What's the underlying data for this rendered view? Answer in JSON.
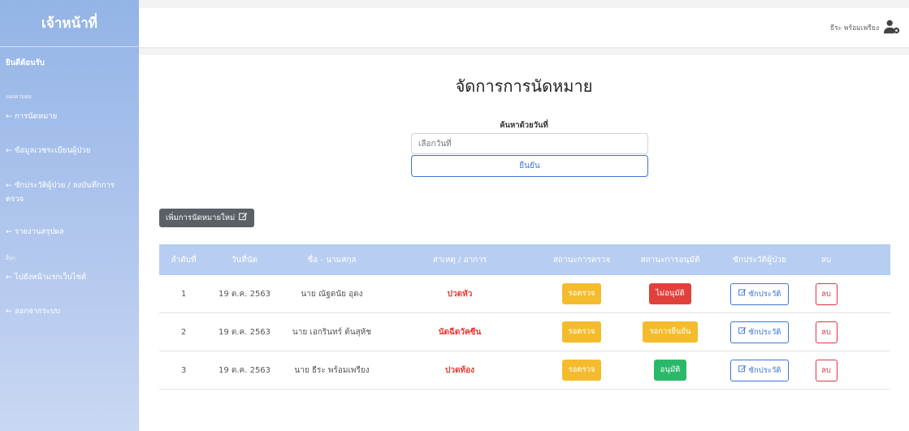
{
  "sidebar": {
    "brand": "เจ้าหน้าที่",
    "welcome": "ยินดีต้อนรับ",
    "section_control": "แผงควบคุม",
    "items": [
      {
        "label": "← การนัดหมาย"
      },
      {
        "label": "← ข้อมูลเวชระเบียนผู้ป่วย"
      },
      {
        "label": "← ซักประวัติผู้ป่วย / ลงบันทึกการ"
      },
      {
        "label": "ตรวจ"
      },
      {
        "label": "← รายงานสรุปผล"
      }
    ],
    "section_other": "อื่นๆ",
    "other_items": [
      {
        "label": "← ไปยังหน้าแรกเว็บไซต์"
      },
      {
        "label": "← ออกจากระบบ"
      }
    ]
  },
  "topbar": {
    "user_name": "ธีระ พร้อมเพรียง",
    "user_icon": "user-cog-icon"
  },
  "main": {
    "title": "จัดการการนัดหมาย",
    "search_label": "ค้นหาด้วยวันที่",
    "date_placeholder": "เลือกวันที่",
    "confirm_label": "ยืนยัน",
    "add_label": "เพิ่มการนัดหมายใหม่"
  },
  "table": {
    "headers": [
      "ลำดับที่",
      "วันที่นัด",
      "ชื่อ - นามสกุล",
      "สาเหตุ / อาการ",
      "สถานะการตรวจ",
      "สถานะการอนุมัติ",
      "ซักประวัติผู้ป่วย",
      "ลบ"
    ],
    "rows": [
      {
        "no": "1",
        "date": "19 ต.ค. 2563",
        "name": "นาย ณัฐดนัย อุดง",
        "reason": "ปวดหัว",
        "exam_status": "รอตรวจ",
        "exam_color": "#f4bc2c",
        "approval": "ไม่อนุมัติ",
        "approval_color": "#e0413a",
        "history": "ซักประวัติ",
        "delete": "ลบ"
      },
      {
        "no": "2",
        "date": "19 ต.ค. 2563",
        "name": "นาย เอกรินทร์ ต้นสุหัช",
        "reason": "นัดฉีดวัคซีน",
        "exam_status": "รอตรวจ",
        "exam_color": "#f4bc2c",
        "approval": "รอการยืนยัน",
        "approval_color": "#f4bc2c",
        "history": "ซักประวัติ",
        "delete": "ลบ"
      },
      {
        "no": "3",
        "date": "19 ต.ค. 2563",
        "name": "นาย ธีระ พร้อมเพรียง",
        "reason": "ปวดท้อง",
        "exam_status": "รอตรวจ",
        "exam_color": "#f4bc2c",
        "approval": "อนุมัติ",
        "approval_color": "#2cb869",
        "history": "ซักประวัติ",
        "delete": "ลบ"
      }
    ]
  },
  "colors": {
    "accent": "#3d75d6",
    "sidebar": "#93b4e6",
    "header_row": "#b7cdf1",
    "danger": "#dc3545"
  }
}
